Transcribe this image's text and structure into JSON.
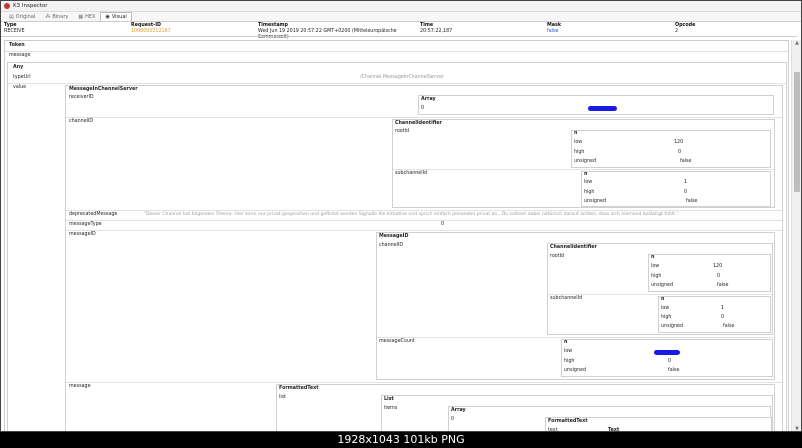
{
  "window": {
    "title": "K3 Inspector"
  },
  "tabs": [
    {
      "label": "Original",
      "icon": "document-icon"
    },
    {
      "label": "Binary",
      "icon": "binary-icon"
    },
    {
      "label": "HEX",
      "icon": "hex-icon"
    },
    {
      "label": "Visual",
      "icon": "eye-icon"
    }
  ],
  "header": {
    "columns": [
      "Type",
      "Request-ID",
      "Timestamp",
      "Time",
      "Mask",
      "Opcode"
    ],
    "values": [
      "RECEIVE",
      "1000000212187",
      "Wed Jun 19 2019 20:57:22 GMT+0200 (Mitteleuropäische Sommerzeit)",
      "20:57:22,187",
      "false",
      "2"
    ]
  },
  "tree": {
    "token": "Token",
    "message": "message",
    "any": "Any",
    "typeurl_label": "typeUrl",
    "typeurl_value": "/Channel.MessageInChannelServer",
    "value_label": "value",
    "micserver": "MessageInChannelServer",
    "receiverid": "receiverID",
    "array": "Array",
    "zero": "0",
    "channelid": "channelID",
    "channelidentifier": "ChannelIdentifier",
    "rootid": "rootId",
    "n": "n",
    "low": "low",
    "high": "high",
    "unsigned": "unsigned",
    "false": "false",
    "v120": "120",
    "v1": "1",
    "subchannelid": "subchannelId",
    "deprecated_label": "deprecatedMessage",
    "deprecated_value": "\"Dieser Channel hat folgendes Thema: Hier kann nur privat gesprochen und geflirtet werden Signalle die Initiative und sprich einfach jemanden privat an.. Du solltest dabei natürlich darauf achten, dass sich niemand belästigt fühlt.\"",
    "messagetype_label": "messageType",
    "messagetype_value": "0",
    "messageid_label": "messageID",
    "messageid_type": "MessageID",
    "messagecount": "messageCount",
    "message2_label": "message",
    "formattedtext": "FormattedText",
    "list": "list",
    "list_type": "List",
    "items": "items",
    "text": "text",
    "text_type": "Text"
  },
  "caption": "1928x1043  101kb  PNG"
}
